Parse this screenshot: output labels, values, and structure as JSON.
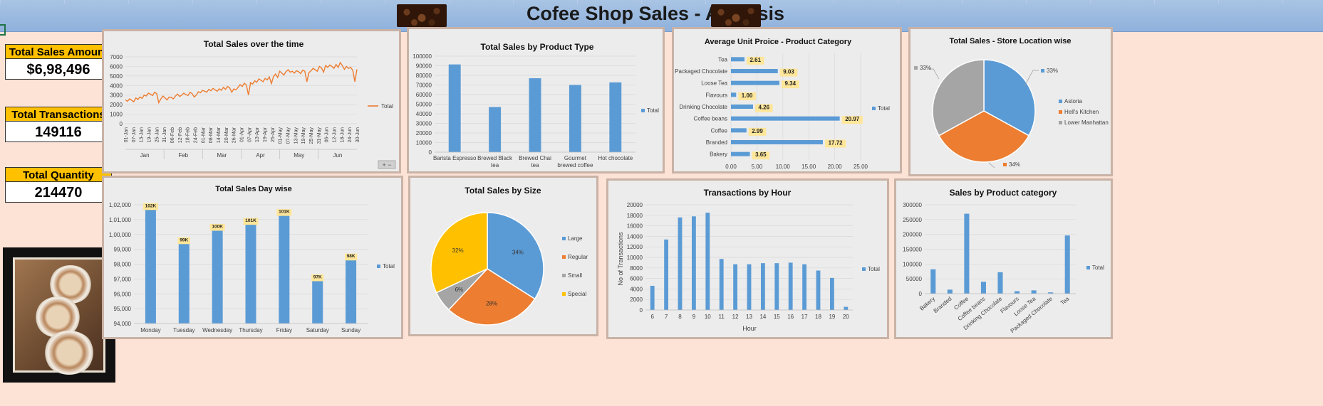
{
  "header": {
    "title": "Cofee Shop Sales - Analysis"
  },
  "kpis": [
    {
      "label": "Total Sales Amount",
      "value": "$6,98,496"
    },
    {
      "label": "Total Transactions",
      "value": "149116"
    },
    {
      "label": "Total Quantity",
      "value": "214470"
    }
  ],
  "colors": {
    "blue": "#5b9bd5",
    "orange": "#ed7d31",
    "gray": "#a5a5a5",
    "yellow": "#ffc000",
    "label_bg": "#ffe699"
  },
  "chart_data": [
    {
      "id": "sales_over_time",
      "type": "line",
      "title": "Total Sales over the time",
      "x_ticks": [
        "01-Jan",
        "07-Jan",
        "13-Jan",
        "19-Jan",
        "25-Jan",
        "31-Jan",
        "06-Feb",
        "12-Feb",
        "18-Feb",
        "24-Feb",
        "01-Mar",
        "08-Mar",
        "14-Mar",
        "20-Mar",
        "26-Mar",
        "01-Apr",
        "07-Apr",
        "13-Apr",
        "19-Apr",
        "25-Apr",
        "01-May",
        "07-May",
        "13-May",
        "19-May",
        "25-May",
        "31-May",
        "06-Jun",
        "12-Jun",
        "18-Jun",
        "24-Jun",
        "30-Jun"
      ],
      "months": [
        "Jan",
        "Feb",
        "Mar",
        "Apr",
        "May",
        "Jun"
      ],
      "y_ticks": [
        "0",
        "1000",
        "2000",
        "3000",
        "4000",
        "5000",
        "6000",
        "7000"
      ],
      "ylim": [
        0,
        7000
      ],
      "series": [
        {
          "name": "Total",
          "color": "#ed7d31",
          "values": [
            2500,
            2350,
            2600,
            2450,
            2300,
            2700,
            2550,
            2800,
            2650,
            3000,
            2900,
            3200,
            3100,
            2950,
            3300,
            3150,
            2200,
            2600,
            2900,
            2700,
            2500,
            2800,
            2750,
            2600,
            2900,
            3100,
            2850,
            3000,
            3200,
            3050,
            2950,
            3300,
            3150,
            2800,
            3000,
            3350,
            3250,
            3500,
            3400,
            3300,
            3600,
            3450,
            3700,
            3550,
            3400,
            3650,
            3500,
            3800,
            3600,
            3900,
            3750,
            3300,
            3650,
            3550,
            3800,
            4100,
            3900,
            4250,
            4050,
            3000,
            4300,
            4150,
            4500,
            4350,
            4700,
            4550,
            4400,
            4750,
            4600,
            4900,
            4200,
            4950,
            5200,
            4850,
            5500,
            5300,
            5100,
            5450,
            5650,
            5400,
            5500,
            5300,
            5550,
            5450,
            5250,
            5600,
            5500,
            4400,
            5350,
            5550,
            5800,
            5650,
            5500,
            6000,
            5850,
            5400,
            6100,
            5900,
            6150,
            6000,
            5800,
            6200,
            5900,
            6400,
            6100,
            5700,
            6000,
            5800,
            5900,
            5600,
            4400,
            5700
          ]
        }
      ]
    },
    {
      "id": "sales_by_product_type",
      "type": "bar",
      "title": "Total Sales by Product Type",
      "categories": [
        "Barista Espresso",
        "Brewed Black tea",
        "Brewed Chai tea",
        "Gourmet brewed coffee",
        "Hot chocolate"
      ],
      "category_lines": [
        [
          "Barista Espresso"
        ],
        [
          "Brewed Black",
          "tea"
        ],
        [
          "Brewed Chai",
          "tea"
        ],
        [
          "Gourmet",
          "brewed coffee"
        ],
        [
          "Hot chocolate"
        ]
      ],
      "y_ticks": [
        "0",
        "10000",
        "20000",
        "30000",
        "40000",
        "50000",
        "60000",
        "70000",
        "80000",
        "90000",
        "100000"
      ],
      "ylim": [
        0,
        100000
      ],
      "series": [
        {
          "name": "Total",
          "values": [
            91400,
            47000,
            77000,
            70000,
            72700
          ]
        }
      ]
    },
    {
      "id": "avg_unit_price",
      "type": "bar",
      "orientation": "horizontal",
      "title": "Average Unit Proice - Product Category",
      "categories": [
        "Tea",
        "Packaged Chocolate",
        "Loose Tea",
        "Flavours",
        "Drinking Chocolate",
        "Coffee beans",
        "Coffee",
        "Branded",
        "Bakery"
      ],
      "x_ticks": [
        "0.00",
        "5.00",
        "10.00",
        "15.00",
        "20.00",
        "25.00"
      ],
      "xlim": [
        0,
        25
      ],
      "series": [
        {
          "name": "Total",
          "values": [
            2.61,
            9.03,
            9.34,
            1.0,
            4.26,
            20.97,
            2.99,
            17.72,
            3.65
          ],
          "labels": [
            "2.61",
            "9.03",
            "9.34",
            "1.00",
            "4.26",
            "20.97",
            "2.99",
            "17.72",
            "3.65"
          ]
        }
      ]
    },
    {
      "id": "store_location",
      "type": "pie",
      "title": "Total Sales - Store Location wise",
      "series": [
        {
          "name": "Total",
          "categories": [
            "Astoria",
            "Hell's Kitchen",
            "Lower Manhattan"
          ],
          "values": [
            33,
            34,
            33
          ],
          "labels": [
            "33%",
            "34%",
            "33%"
          ],
          "colors": [
            "#5b9bd5",
            "#ed7d31",
            "#a5a5a5"
          ]
        }
      ]
    },
    {
      "id": "sales_day_wise",
      "type": "bar",
      "title": "Total Sales Day wise",
      "categories": [
        "Monday",
        "Tuesday",
        "Wednesday",
        "Thursday",
        "Friday",
        "Saturday",
        "Sunday"
      ],
      "y_ticks": [
        "94,000",
        "95,000",
        "96,000",
        "97,000",
        "98,000",
        "99,000",
        "1,00,000",
        "1,01,000",
        "1,02,000"
      ],
      "ylim": [
        94000,
        102000
      ],
      "series": [
        {
          "name": "Total",
          "values": [
            101700,
            99400,
            100300,
            100700,
            101300,
            96900,
            98300
          ],
          "labels": [
            "102K",
            "99K",
            "100K",
            "101K",
            "101K",
            "97K",
            "98K"
          ]
        }
      ]
    },
    {
      "id": "sales_by_size",
      "type": "pie",
      "title": "Total Sales by Size",
      "series": [
        {
          "name": "Total",
          "categories": [
            "Large",
            "Regular",
            "Small",
            "Special"
          ],
          "values": [
            34,
            28,
            6,
            32
          ],
          "labels": [
            "34%",
            "28%",
            "6%",
            "32%"
          ],
          "colors": [
            "#5b9bd5",
            "#ed7d31",
            "#a5a5a5",
            "#ffc000"
          ]
        }
      ]
    },
    {
      "id": "transactions_by_hour",
      "type": "bar",
      "title": "Transactions by Hour",
      "xlabel": "Hour",
      "ylabel": "No of Transactions",
      "categories": [
        "6",
        "7",
        "8",
        "9",
        "10",
        "11",
        "12",
        "13",
        "14",
        "15",
        "16",
        "17",
        "18",
        "19",
        "20"
      ],
      "y_ticks": [
        "0",
        "2000",
        "4000",
        "6000",
        "8000",
        "10000",
        "12000",
        "14000",
        "16000",
        "18000",
        "20000"
      ],
      "ylim": [
        0,
        20000
      ],
      "series": [
        {
          "name": "Total",
          "values": [
            4600,
            13400,
            17600,
            17800,
            18500,
            9700,
            8700,
            8700,
            8900,
            8900,
            9000,
            8700,
            7500,
            6100,
            600
          ]
        }
      ]
    },
    {
      "id": "sales_by_product_category",
      "type": "bar",
      "title": "Sales by Product category",
      "categories": [
        "Bakery",
        "Branded",
        "Coffee",
        "Coffee beans",
        "Drinking Chocolate",
        "Flavours",
        "Loose Tea",
        "Packaged Chocolate",
        "Tea"
      ],
      "y_ticks": [
        "0",
        "50000",
        "100000",
        "150000",
        "200000",
        "250000",
        "300000"
      ],
      "ylim": [
        0,
        300000
      ],
      "series": [
        {
          "name": "Total",
          "values": [
            82300,
            13600,
            269900,
            40100,
            72400,
            8400,
            11200,
            4400,
            196400
          ]
        }
      ]
    }
  ]
}
